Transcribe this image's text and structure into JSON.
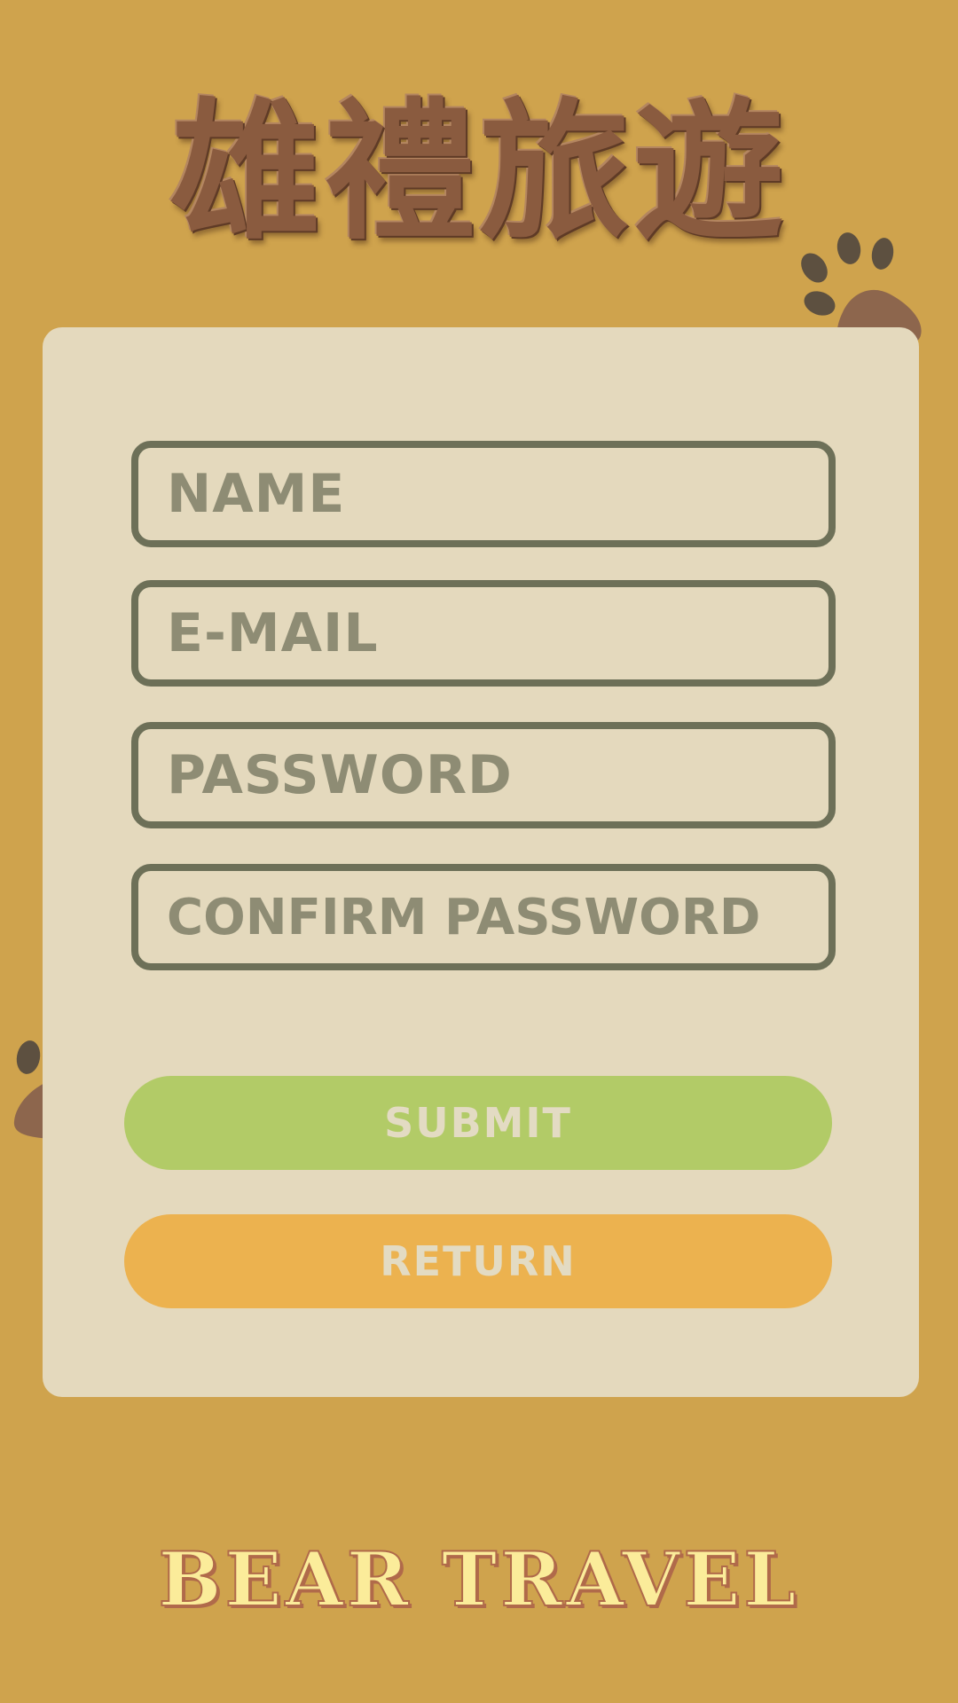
{
  "header": {
    "logo_text": "雄禮旅遊"
  },
  "form": {
    "name_placeholder": "NAME",
    "email_placeholder": "E-MAIL",
    "password_placeholder": "PASSWORD",
    "confirm_password_placeholder": "CONFIRM PASSWORD",
    "submit_label": "SUBMIT",
    "return_label": "RETURN"
  },
  "footer": {
    "brand_text": "BEAR TRAVEL"
  },
  "icons": {
    "top_right": "paw-print-icon",
    "left": "paw-print-icon"
  },
  "colors": {
    "background": "#cfa34d",
    "card": "#e4d9bd",
    "field_border": "#6d7058",
    "placeholder": "#8e8c74",
    "submit": "#b2cb67",
    "return": "#ecb24f",
    "paw_pad": "#8d664d",
    "paw_toe": "#5d5040",
    "logo": "#8a5b3f",
    "footer_text": "#fbec9a"
  }
}
